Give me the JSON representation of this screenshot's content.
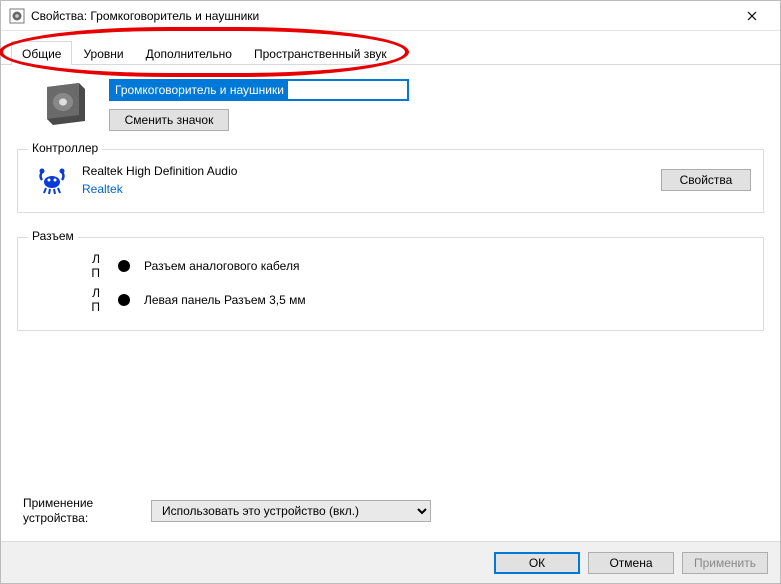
{
  "window": {
    "title": "Свойства: Громкоговоритель и наушники"
  },
  "tabs": [
    {
      "label": "Общие",
      "active": true
    },
    {
      "label": "Уровни",
      "active": false
    },
    {
      "label": "Дополнительно",
      "active": false
    },
    {
      "label": "Пространственный звук",
      "active": false
    }
  ],
  "device": {
    "name_value": "Громкоговоритель и наушники",
    "change_icon_label": "Сменить значок"
  },
  "controller": {
    "legend": "Контроллер",
    "name": "Realtek High Definition Audio",
    "vendor": "Realtek",
    "properties_button": "Свойства"
  },
  "jack": {
    "legend": "Разъем",
    "rows": [
      {
        "lr": "Л П",
        "label": "Разъем аналогового кабеля"
      },
      {
        "lr": "Л П",
        "label": "Левая панель Разъем 3,5 мм"
      }
    ]
  },
  "usage": {
    "label": "Применение устройства:",
    "selected": "Использовать это устройство (вкл.)"
  },
  "footer": {
    "ok": "ОК",
    "cancel": "Отмена",
    "apply": "Применить"
  }
}
